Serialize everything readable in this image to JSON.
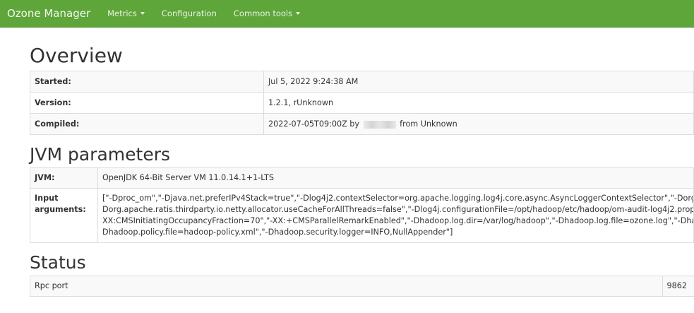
{
  "navbar": {
    "brand": "Ozone Manager",
    "items": [
      {
        "label": "Metrics",
        "dropdown": true
      },
      {
        "label": "Configuration",
        "dropdown": false
      },
      {
        "label": "Common tools",
        "dropdown": true
      }
    ],
    "color": "#5ea63a"
  },
  "overview": {
    "title": "Overview",
    "rows": [
      {
        "label": "Started:",
        "value": "Jul 5, 2022 9:24:38 AM"
      },
      {
        "label": "Version:",
        "value": "1.2.1, rUnknown"
      },
      {
        "label": "Compiled:",
        "value_prefix": "2022-07-05T09:00Z by",
        "value_suffix": "from Unknown"
      }
    ]
  },
  "jvm": {
    "title": "JVM parameters",
    "jvm_label": "JVM:",
    "jvm_value": "OpenJDK 64-Bit Server VM 11.0.14.1+1-LTS",
    "args_label": "Input arguments:",
    "args_lines": [
      "[\"-Dproc_om\",\"-Djava.net.preferIPv4Stack=true\",\"-Dlog4j2.contextSelector=org.apache.logging.log4j.core.async.AsyncLoggerContextSelector\",\"-Dorg",
      "Dorg.apache.ratis.thirdparty.io.netty.allocator.useCacheForAllThreads=false\",\"-Dlog4j.configurationFile=/opt/hadoop/etc/hadoop/om-audit-log4j2.prop",
      "XX:CMSInitiatingOccupancyFraction=70\",\"-XX:+CMSParallelRemarkEnabled\",\"-Dhadoop.log.dir=/var/log/hadoop\",\"-Dhadoop.log.file=ozone.log\",\"-Dha",
      "Dhadoop.policy.file=hadoop-policy.xml\",\"-Dhadoop.security.logger=INFO,NullAppender\"]"
    ]
  },
  "status": {
    "title": "Status",
    "rows": [
      {
        "name": "Rpc port",
        "value": "9862"
      }
    ]
  }
}
